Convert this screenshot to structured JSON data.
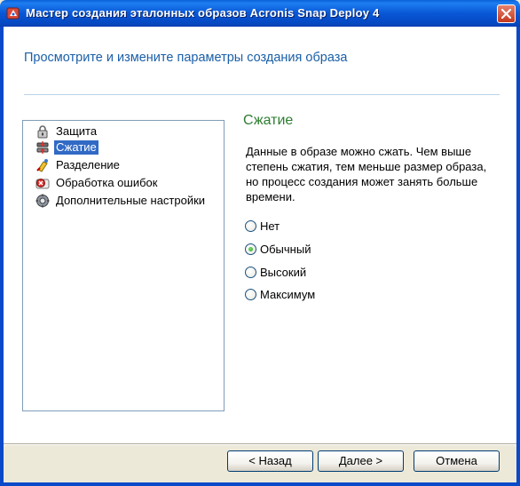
{
  "window": {
    "title": "Мастер создания эталонных образов Acronis Snap Deploy 4",
    "close_icon": "close-icon"
  },
  "header": {
    "title": "Просмотрите и измените параметры создания образа"
  },
  "tree": {
    "items": [
      {
        "label": "Защита",
        "icon": "lock-icon",
        "selected": false
      },
      {
        "label": "Сжатие",
        "icon": "compression-icon",
        "selected": true
      },
      {
        "label": "Разделение",
        "icon": "split-icon",
        "selected": false
      },
      {
        "label": "Обработка ошибок",
        "icon": "error-handling-icon",
        "selected": false
      },
      {
        "label": "Дополнительные настройки",
        "icon": "gear-icon",
        "selected": false
      }
    ]
  },
  "section": {
    "title": "Сжатие",
    "description": "Данные в образе можно сжать. Чем выше степень сжатия, тем меньше размер образа, но процесс создания может занять больше времени.",
    "options": [
      {
        "label": "Нет",
        "checked": false
      },
      {
        "label": "Обычный",
        "checked": true
      },
      {
        "label": "Высокий",
        "checked": false
      },
      {
        "label": "Максимум",
        "checked": false
      }
    ]
  },
  "buttons": {
    "back": "< Назад",
    "next": "Далее >",
    "cancel": "Отмена"
  }
}
